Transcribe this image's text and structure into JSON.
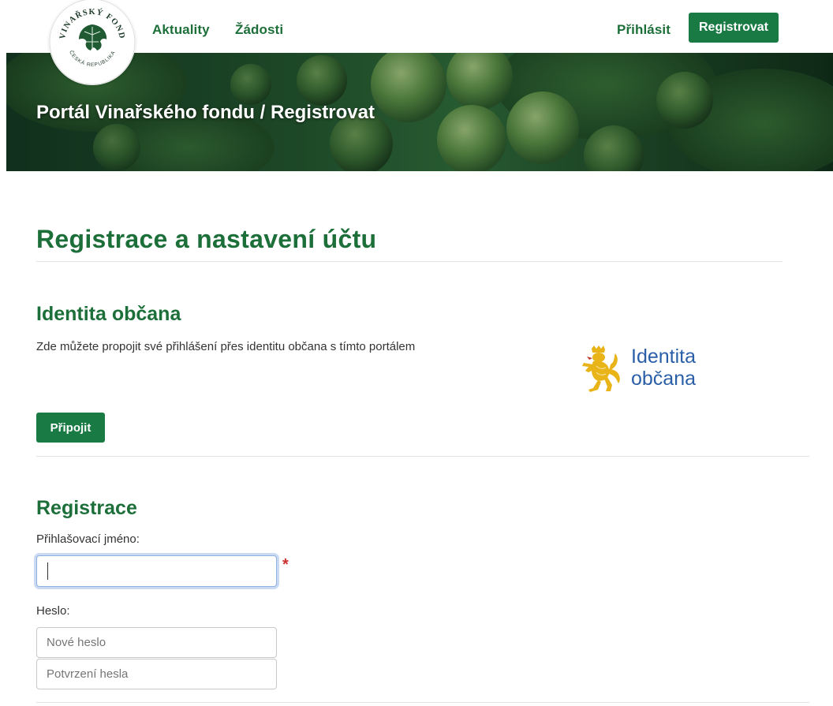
{
  "navbar": {
    "logo": {
      "text_top": "VINAŘSKÝ FOND",
      "text_bottom": "ČESKÁ REPUBLIKA",
      "icon": "grape-leaf-logo"
    },
    "links": [
      {
        "label": "Aktuality"
      },
      {
        "label": "Žádosti"
      }
    ],
    "login_label": "Přihlásit",
    "register_label": "Registrovat"
  },
  "hero": {
    "title": "Portál Vinařského fondu / Registrovat"
  },
  "main": {
    "heading": "Registrace a nastavení účtu",
    "identity": {
      "title": "Identita občana",
      "description": "Zde můžete propojit své přihlášení přes identitu občana s tímto portálem",
      "logo_text_line1": "Identita",
      "logo_text_line2": "občana",
      "logo_icon": "czech-lion-icon",
      "connect_label": "Připojit"
    },
    "registration": {
      "title": "Registrace",
      "username_label": "Přihlašovací jméno:",
      "username_value": "",
      "required_mark": "*",
      "password_label": "Heslo:",
      "new_password_placeholder": "Nové heslo",
      "confirm_password_placeholder": "Potvrzení hesla"
    }
  },
  "colors": {
    "brand_green": "#1d6f3a",
    "button_green": "#1a7a44",
    "identity_blue": "#2a5fa8",
    "lion_gold": "#e8b417",
    "required_red": "#c9302c"
  }
}
